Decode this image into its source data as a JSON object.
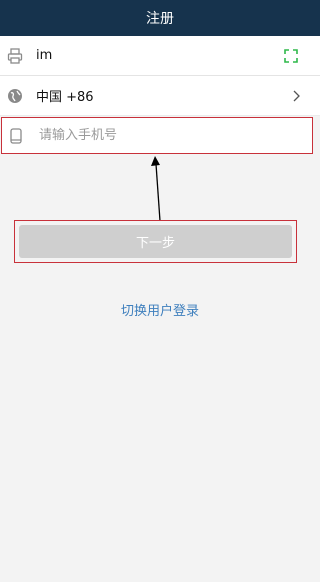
{
  "header": {
    "title": "注册"
  },
  "form": {
    "server_value": "im",
    "country_value": "中国 +86",
    "phone_placeholder": "请输入手机号"
  },
  "buttons": {
    "next_label": "下一步"
  },
  "links": {
    "switch_login": "切换用户登录"
  },
  "colors": {
    "header_bg": "#16334d",
    "highlight_border": "#c8313a",
    "link": "#3e7fbd",
    "scan_icon": "#2eb84a",
    "button_disabled": "#cfcfcf"
  },
  "icons": {
    "server": "printer-icon",
    "country": "globe-icon",
    "phone": "phone-icon",
    "scan": "scan-icon",
    "more": "chevron-right-icon"
  }
}
